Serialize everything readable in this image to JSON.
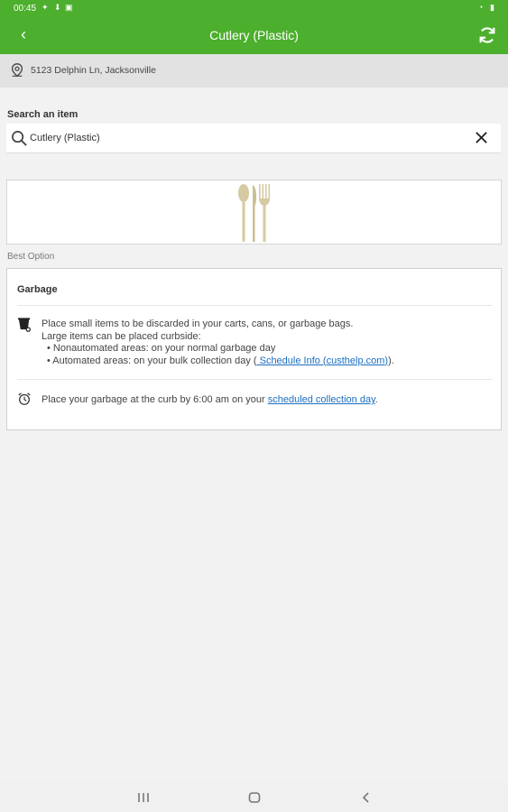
{
  "status_bar": {
    "time": "00:45"
  },
  "app_bar": {
    "title": "Cutlery (Plastic)"
  },
  "location": {
    "address": "5123 Delphin Ln, Jacksonville"
  },
  "search": {
    "label": "Search an item",
    "value": "Cutlery (Plastic)"
  },
  "best_option_label": "Best Option",
  "card": {
    "title": "Garbage",
    "line1": "Place small items to be discarded in your carts, cans, or garbage bags.",
    "line2": "Large items can be placed curbside:",
    "bullet1": "• Nonautomated areas:  on your normal garbage day",
    "bullet2_prefix": "• Automated areas:  on your bulk collection day (",
    "bullet2_link": " Schedule Info (custhelp.com)",
    "bullet2_suffix": ").",
    "collection_prefix": "Place your garbage at the curb by 6:00 am on your ",
    "collection_link": "scheduled collection day",
    "collection_suffix": "."
  },
  "colors": {
    "brand_green": "#4caf2d",
    "link_blue": "#1a6fc0"
  },
  "icons": [
    "back-arrow-icon",
    "refresh-icon",
    "location-pin-icon",
    "search-icon",
    "close-icon",
    "cutlery-image",
    "garbage-cart-icon",
    "alarm-clock-icon",
    "recents-icon",
    "home-icon",
    "nav-back-icon"
  ]
}
